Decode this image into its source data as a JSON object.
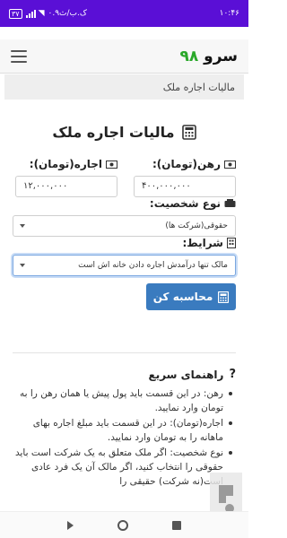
{
  "statusbar": {
    "time": "۱۰:۴۶",
    "battery": "۳۷",
    "network": "۰.۹ک.ب/ث"
  },
  "appbar": {
    "brand_number": "۹۸",
    "brand_word": "سرو",
    "menu_icon": "hamburger-icon"
  },
  "breadcrumb": "مالیات اجاره ملک",
  "form": {
    "title": "مالیات اجاره ملک",
    "title_icon": "calculator-icon",
    "rahn_label": "رهن(تومان):",
    "rahn_value": "۴۰۰,۰۰۰,۰۰۰",
    "ejare_label": "اجاره(تومان):",
    "ejare_value": "۱۲,۰۰۰,۰۰۰",
    "person_type_label": "نوع شخصیت:",
    "person_type_value": "حقوقی(شرکت ها)",
    "conditions_label": "شرایط:",
    "conditions_value": "مالک تنها درآمدش اجاره دادن خانه اش است",
    "calc_button": "محاسبه کن"
  },
  "guide": {
    "title": "راهنمای سریع",
    "items": [
      "رهن: در این قسمت باید پول پیش یا همان رهن را به تومان وارد نمایید.",
      "اجاره(تومان): در این قسمت باید مبلغ اجاره بهای ماهانه را به تومان وارد نمایید.",
      "نوع شخصیت: اگر ملک متعلق به یک شرکت است باید حقوقی را انتخاب کنید، اگر مالک آن یک فرد عادی است(نه شرکت) حقیقی را"
    ]
  },
  "colors": {
    "statusbar": "#5a0fd6",
    "brand_green": "#2aa82a",
    "button_blue": "#3a7bbf"
  }
}
